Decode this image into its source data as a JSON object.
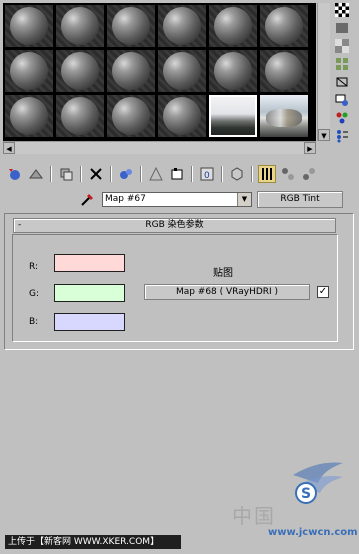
{
  "material_name": "Map #67",
  "map_type_button": "RGB Tint",
  "rollout": {
    "collapse_symbol": "-",
    "title": "RGB 染色参数"
  },
  "channels": [
    {
      "label": "R:",
      "color": "#ffd8d8"
    },
    {
      "label": "G:",
      "color": "#d8ffd8"
    },
    {
      "label": "B:",
      "color": "#d8d8ff"
    }
  ],
  "map_section": {
    "label": "贴图",
    "button": "Map #68   ( VRayHDRI )",
    "checked": true,
    "check_symbol": "✓"
  },
  "slots": {
    "rows": 3,
    "cols": 6,
    "selected_index": 16,
    "hdri_slots": [
      16,
      17
    ]
  },
  "watermark": {
    "site_cn": "中国",
    "site_url": "www.jcwcn.com",
    "logo_text": "S"
  },
  "caption": "上传于【新客网 WWW.XKER.COM】"
}
